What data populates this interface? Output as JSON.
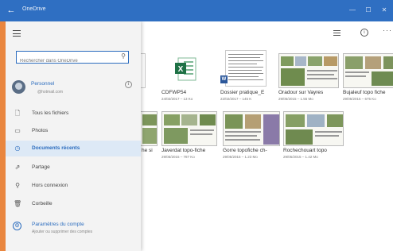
{
  "window": {
    "title": "OneDrive",
    "back_glyph": "←",
    "minimize_glyph": "—",
    "maximize_glyph": "☐",
    "close_glyph": "✕"
  },
  "search": {
    "placeholder": "Rechercher dans OneDrive",
    "icon": "search-icon"
  },
  "account": {
    "name": "Personnel",
    "email": "@hotmail.com",
    "info_glyph": "i"
  },
  "nav": [
    {
      "label": "Tous les fichiers",
      "icon": "document-icon",
      "glyph": "🗋"
    },
    {
      "label": "Photos",
      "icon": "photo-icon",
      "glyph": "▭"
    },
    {
      "label": "Documents récents",
      "icon": "clock-icon",
      "glyph": "◷",
      "active": true
    },
    {
      "label": "Partage",
      "icon": "share-icon",
      "glyph": "⇗"
    },
    {
      "label": "Hors connexion",
      "icon": "offline-pin-icon",
      "glyph": "⚲"
    },
    {
      "label": "Corbeille",
      "icon": "trash-icon",
      "glyph": "🗑"
    }
  ],
  "settings": {
    "label": "Paramètres du compte",
    "sub": "Ajouter ou supprimer des comptes",
    "glyph": "⚙"
  },
  "toolbar": {
    "info_glyph": "i",
    "more_glyph": "···"
  },
  "files_row1": [
    {
      "name": "CDFWP54",
      "meta": "24/02/2017 – 13 Ko",
      "kind": "excel",
      "icon_letter": "X"
    },
    {
      "name": "Dossier pratique_E",
      "meta": "22/02/2017 – 145 K",
      "kind": "word",
      "icon_letter": "W"
    },
    {
      "name": "Oradour sur Vayres",
      "meta": "29/05/2015 – 1.55 Mo",
      "kind": "photo"
    },
    {
      "name": "Bujaleuf topo fiche",
      "meta": "29/05/2015 – 675 Ko",
      "kind": "photo"
    }
  ],
  "files_row2": [
    {
      "name": "he si",
      "meta": "",
      "kind": "photo"
    },
    {
      "name": "Javerdat topo-fiche",
      "meta": "29/05/2015 – 787 Ko",
      "kind": "photo"
    },
    {
      "name": "Gorre topofiche ch-",
      "meta": "29/05/2015 – 1.23 Mo",
      "kind": "photo"
    },
    {
      "name": "Rochechouart topo",
      "meta": "29/05/2015 – 1.42 Mo",
      "kind": "photo"
    }
  ],
  "colors": {
    "accent": "#2b6cbe",
    "titlebar": "#2f6fc2",
    "frame": "#e9863f",
    "excel": "#1e7145",
    "word": "#2b579a"
  }
}
